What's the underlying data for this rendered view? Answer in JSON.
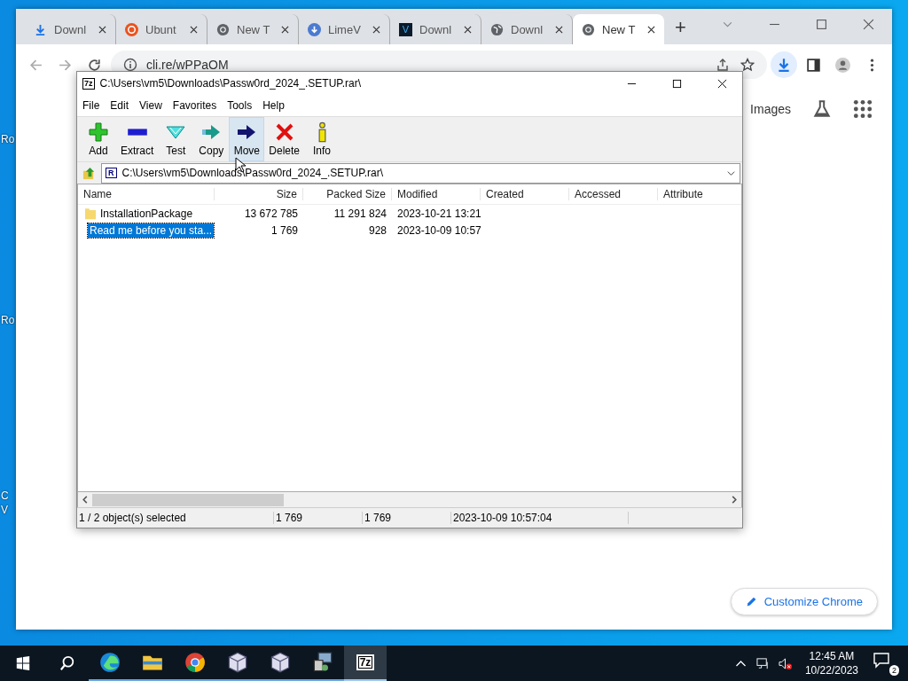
{
  "desktop": {
    "icon_labels": [
      "Ro",
      "Ro",
      "C",
      "V"
    ]
  },
  "browser": {
    "tabs": [
      {
        "title": "Downl",
        "kind": "download",
        "selected": false
      },
      {
        "title": "Ubunt",
        "kind": "ubuntu",
        "selected": false
      },
      {
        "title": "New T",
        "kind": "chrome",
        "selected": false
      },
      {
        "title": "LimeV",
        "kind": "download-circle",
        "selected": false
      },
      {
        "title": "Downl",
        "kind": "letter",
        "favicon_text": "V",
        "selected": false
      },
      {
        "title": "Downl",
        "kind": "globe",
        "selected": false
      },
      {
        "title": "New T",
        "kind": "chrome",
        "selected": true
      }
    ],
    "new_tab": "+",
    "address": "cli.re/wPPaOM",
    "downloads_active": true,
    "page": {
      "link": "Images",
      "customize_button": "Customize Chrome"
    }
  },
  "archive_window": {
    "title": "C:\\Users\\vm5\\Downloads\\Passw0rd_2024_.SETUP.rar\\",
    "logo_text": "7z",
    "menu": [
      "File",
      "Edit",
      "View",
      "Favorites",
      "Tools",
      "Help"
    ],
    "toolbar": [
      {
        "label": "Add",
        "kind": "add",
        "hovered": false
      },
      {
        "label": "Extract",
        "kind": "extract",
        "hovered": false
      },
      {
        "label": "Test",
        "kind": "test",
        "hovered": false
      },
      {
        "label": "Copy",
        "kind": "copy",
        "hovered": false
      },
      {
        "label": "Move",
        "kind": "move",
        "hovered": true
      },
      {
        "label": "Delete",
        "kind": "delete",
        "hovered": false
      },
      {
        "label": "Info",
        "kind": "info",
        "hovered": false
      }
    ],
    "path": "C:\\Users\\vm5\\Downloads\\Passw0rd_2024_.SETUP.rar\\",
    "path_icon_text": "R",
    "columns": [
      "Name",
      "Size",
      "Packed Size",
      "Modified",
      "Created",
      "Accessed",
      "Attribute"
    ],
    "rows": [
      {
        "name": "InstallationPackage",
        "kind": "folder",
        "size": "13 672 785",
        "packed": "11 291 824",
        "modified": "2023-10-21 13:21",
        "selected": false
      },
      {
        "name": "Read me before you sta...",
        "kind": "file",
        "size": "1 769",
        "packed": "928",
        "modified": "2023-10-09 10:57",
        "selected": true
      }
    ],
    "status": [
      "1 / 2 object(s) selected",
      "1 769",
      "1 769",
      "2023-10-09 10:57:04"
    ]
  },
  "taskbar": {
    "apps": [
      {
        "kind": "edge",
        "active": false
      },
      {
        "kind": "folder",
        "active": false
      },
      {
        "kind": "chrome",
        "active": false
      },
      {
        "kind": "cube",
        "active": false
      },
      {
        "kind": "cube",
        "active": false
      },
      {
        "kind": "network-app",
        "active": false
      },
      {
        "kind": "sevenzip",
        "label": "7z",
        "active": true
      }
    ],
    "time": "12:45 AM",
    "date": "10/22/2023",
    "notifications": "2"
  }
}
